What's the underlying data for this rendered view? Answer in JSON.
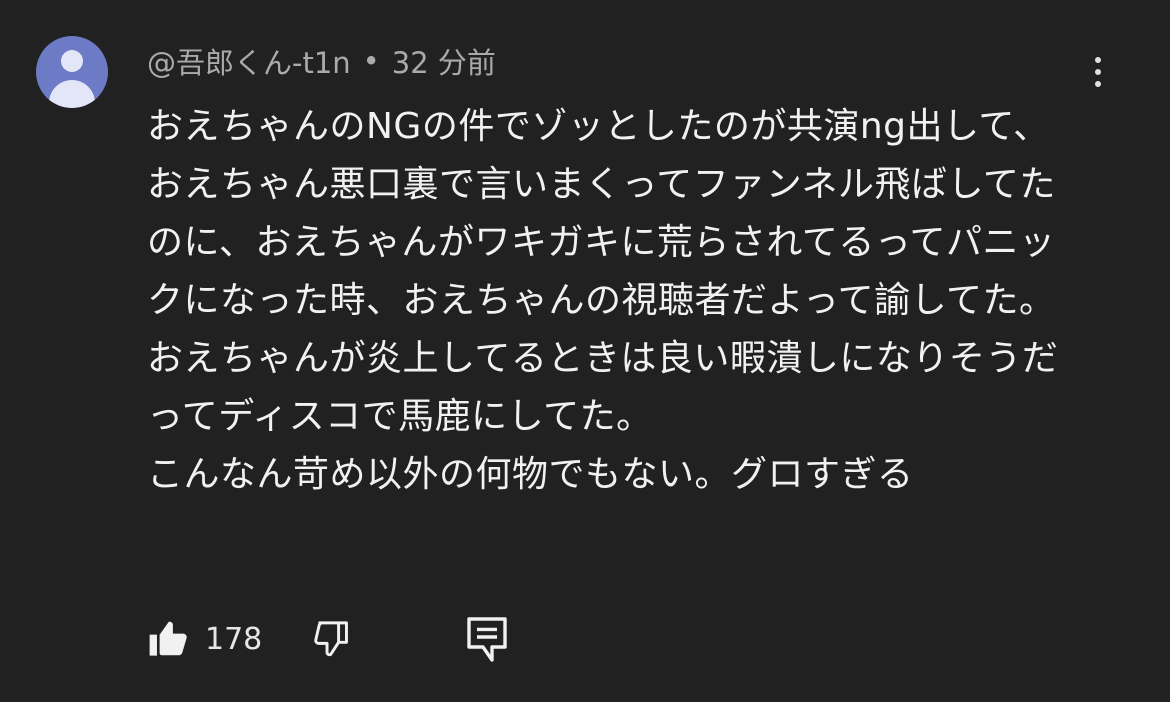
{
  "comment": {
    "author": "@吾郎くん-t1n",
    "separator": "•",
    "time": "32 分前",
    "text": "おえちゃんのNGの件でゾッとしたのが共演ng出して、おえちゃん悪口裏で言いまくってファンネル飛ばしてたのに、おえちゃんがワキガキに荒らされてるってパニックになった時、おえちゃんの視聴者だよって諭してた。おえちゃんが炎上してるときは良い暇潰しになりそうだってディスコで馬鹿にしてた。\nこんなん苛め以外の何物でもない。グロすぎる",
    "like_count": "178"
  },
  "icons": {
    "avatar": "default-avatar-icon",
    "menu": "more-vertical-icon",
    "like": "thumbs-up-filled-icon",
    "dislike": "thumbs-down-outline-icon",
    "reply": "reply-comment-icon"
  },
  "colors": {
    "background": "#212121",
    "text": "#f1f1f1",
    "meta_text": "#aaaaaa",
    "avatar_bg": "#6d7bc7"
  }
}
